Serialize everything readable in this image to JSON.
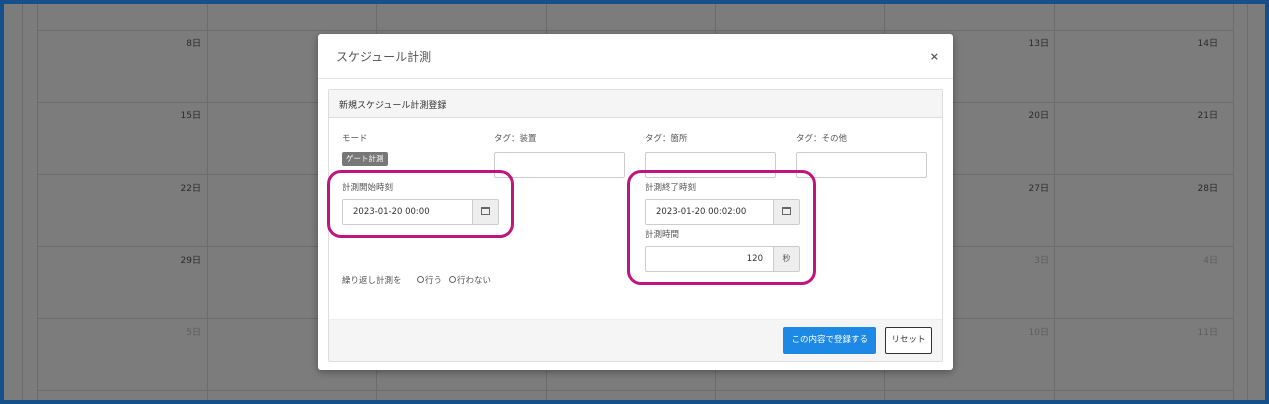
{
  "calendar": {
    "rows": [
      {
        "days": [
          "8日",
          "13日",
          "14日"
        ]
      },
      {
        "days": [
          "15日",
          "20日",
          "21日"
        ]
      },
      {
        "days": [
          "22日",
          "27日",
          "28日"
        ]
      },
      {
        "days": [
          "29日",
          "3日",
          "4日"
        ]
      },
      {
        "days": [
          "5日",
          "10日",
          "11日"
        ]
      }
    ]
  },
  "modal": {
    "title": "スケジュール計測",
    "close": "×",
    "panel_heading": "新規スケジュール計測登録",
    "mode_label": "モード",
    "mode_value": "ゲート計測",
    "tag_device_label": "タグ：装置",
    "tag_location_label": "タグ：箇所",
    "tag_other_label": "タグ：その他",
    "tag_device_value": "",
    "tag_location_value": "",
    "tag_other_value": "",
    "start_label": "計測開始時刻",
    "start_value": "2023-01-20 00:00",
    "end_label": "計測終了時刻",
    "end_value": "2023-01-20 00:02:00",
    "duration_label": "計測時間",
    "duration_value": "120",
    "duration_unit": "秒",
    "repeat_label": "繰り返し計測を",
    "repeat_yes": "行う",
    "repeat_no": "行わない",
    "submit_button": "この内容で登録する",
    "reset_button": "リセット"
  },
  "colors": {
    "primary": "#1e88e5",
    "highlight": "#c0157f",
    "border": "#15508a"
  }
}
